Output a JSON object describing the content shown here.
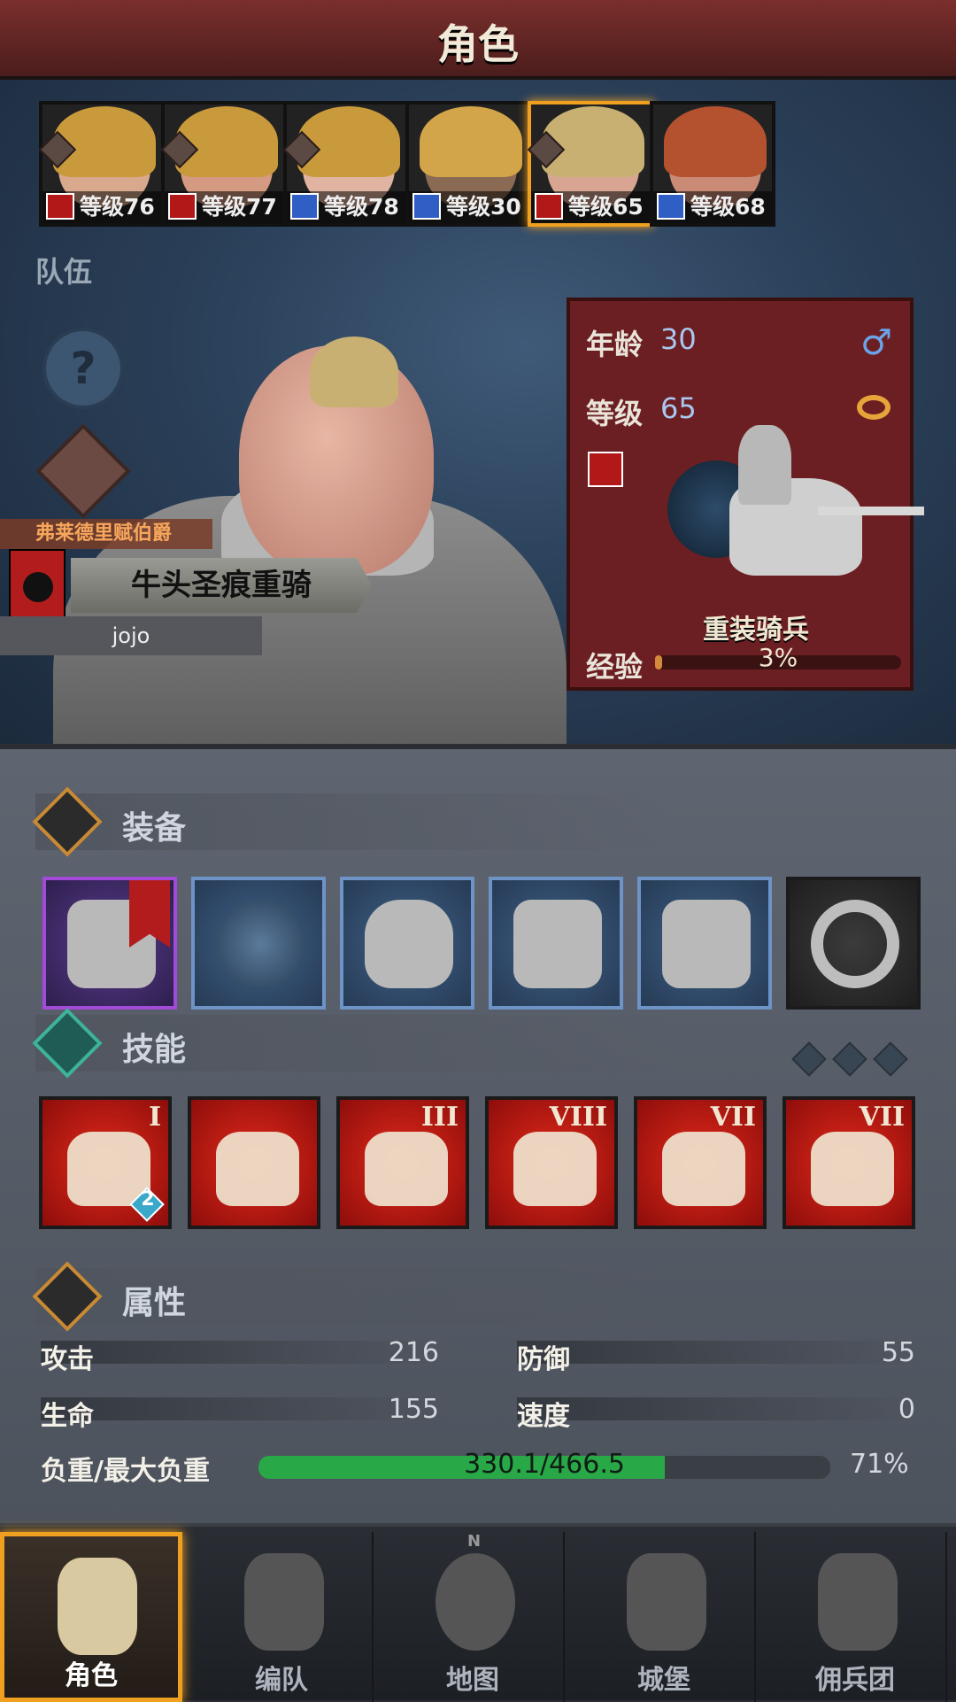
{
  "header": {
    "title": "角色"
  },
  "roster": [
    {
      "level_text": "等级76",
      "class": "red",
      "hair": "#c99a3c",
      "skin": "#d9a98e",
      "selected": false
    },
    {
      "level_text": "等级77",
      "class": "red",
      "hair": "#c99a3c",
      "skin": "#d49a82",
      "selected": false
    },
    {
      "level_text": "等级78",
      "class": "blue",
      "hair": "#c99a3c",
      "skin": "#e0b4a0",
      "selected": false
    },
    {
      "level_text": "等级30",
      "class": "blue",
      "hair": "#d3a54a",
      "skin": "#8a6a52",
      "selected": false
    },
    {
      "level_text": "等级65",
      "class": "red",
      "hair": "#c8b072",
      "skin": "#d7a592",
      "selected": true
    },
    {
      "level_text": "等级68",
      "class": "blue",
      "hair": "#b4522f",
      "skin": "#c98a76",
      "selected": false
    }
  ],
  "team_label": "队伍",
  "help_symbol": "?",
  "hero": {
    "title": "弗莱德里赋伯爵",
    "name": "牛头圣痕重骑",
    "player": "jojo"
  },
  "info": {
    "age_label": "年龄",
    "age_value": "30",
    "gender_symbol": "♂",
    "level_label": "等级",
    "level_value": "65",
    "unit_name": "重装骑兵",
    "exp_label": "经验",
    "exp_text": "3%",
    "exp_fraction": 0.03
  },
  "sections": {
    "equipment": "装备",
    "skills": "技能",
    "attributes": "属性"
  },
  "equipment": [
    {
      "name": "lance",
      "rarity": "purple"
    },
    {
      "name": "plume",
      "rarity": "blue"
    },
    {
      "name": "helmet",
      "rarity": "blue"
    },
    {
      "name": "plate-armor",
      "rarity": "blue"
    },
    {
      "name": "greaves",
      "rarity": "blue"
    },
    {
      "name": "ring",
      "rarity": "black"
    }
  ],
  "skills": [
    {
      "icon": "horse-charge-icon",
      "rank": "I",
      "badge": "2"
    },
    {
      "icon": "horse-upgrade-icon",
      "rank": "",
      "badge": ""
    },
    {
      "icon": "strength-sword-icon",
      "rank": "III",
      "badge": ""
    },
    {
      "icon": "heart-pulse-icon",
      "rank": "VIII",
      "badge": ""
    },
    {
      "icon": "dumbbell-icon",
      "rank": "VII",
      "badge": ""
    },
    {
      "icon": "sword-icon",
      "rank": "VII",
      "badge": ""
    }
  ],
  "stats": {
    "attack_label": "攻击",
    "attack_value": "216",
    "defense_label": "防御",
    "defense_value": "55",
    "hp_label": "生命",
    "hp_value": "155",
    "speed_label": "速度",
    "speed_value": "0",
    "load_label": "负重/最大负重",
    "load_text": "330.1/466.5",
    "load_fraction": 0.71,
    "load_pct": "71%"
  },
  "nav": [
    {
      "label": "角色",
      "icon": "knight-icon",
      "active": true
    },
    {
      "label": "编队",
      "icon": "helmet-icon",
      "active": false
    },
    {
      "label": "地图",
      "icon": "compass-icon",
      "active": false
    },
    {
      "label": "城堡",
      "icon": "castle-icon",
      "active": false
    },
    {
      "label": "佣兵团",
      "icon": "mercenary-banner-icon",
      "active": false
    }
  ],
  "compass_letter": "N"
}
